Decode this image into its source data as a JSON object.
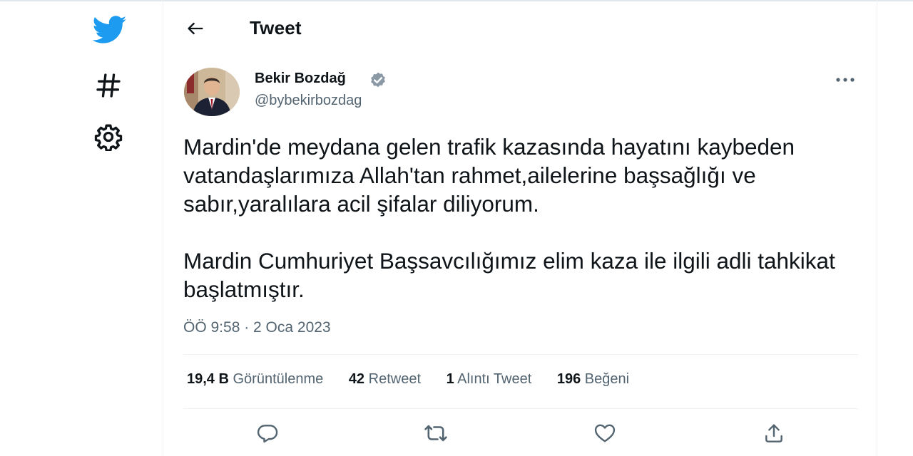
{
  "colors": {
    "accent": "#1d9bf0",
    "text": "#0f1419",
    "muted": "#536471",
    "border": "#eff3f4"
  },
  "sidebar": {
    "icons": [
      "twitter-logo-icon",
      "hashtag-icon",
      "gear-icon"
    ]
  },
  "header": {
    "title": "Tweet"
  },
  "tweet": {
    "author_name": "Bekir Bozdağ",
    "author_handle": "@bybekirbozdag",
    "paragraph_1": "Mardin'de meydana gelen trafik kazasında hayatını kaybeden vatandaşlarımıza Allah'tan rahmet,ailelerine başsağlığı ve sabır,yaralılara acil şifalar diliyorum.",
    "paragraph_2": "Mardin Cumhuriyet Başsavcılığımız elim kaza ile ilgili adli tahkikat başlatmıştır.",
    "timestamp": "ÖÖ 9:58 · 2 Oca 2023"
  },
  "stats": [
    {
      "value": "19,4 B",
      "label": "Görüntülenme"
    },
    {
      "value": "42",
      "label": "Retweet"
    },
    {
      "value": "1",
      "label": "Alıntı Tweet"
    },
    {
      "value": "196",
      "label": "Beğeni"
    }
  ],
  "actions": [
    "reply-icon",
    "retweet-icon",
    "like-icon",
    "share-icon"
  ]
}
